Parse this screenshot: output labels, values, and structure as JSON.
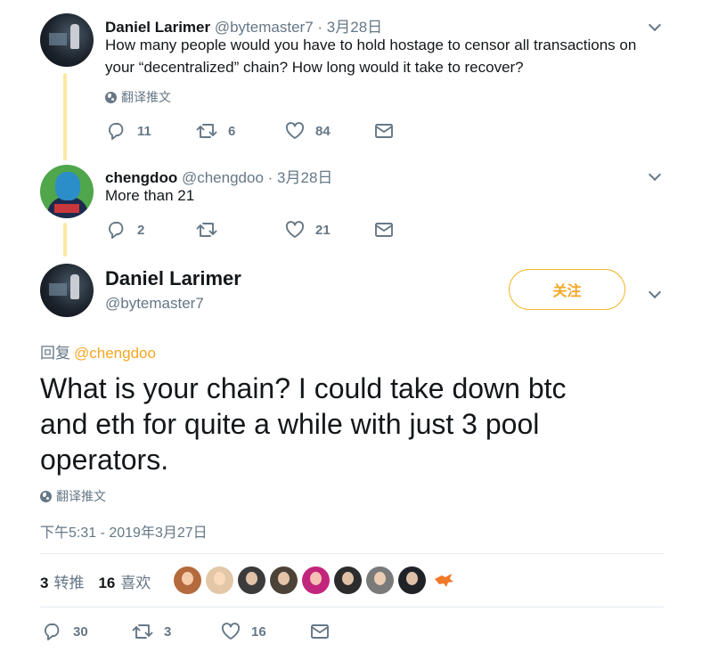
{
  "tweets": [
    {
      "name": "Daniel Larimer",
      "handle": "@bytemaster7",
      "dot": "·",
      "date": "3月28日",
      "text_line1": "How many people would you have to hold hostage to censor all transactions on",
      "text_line2": "your “decentralized” chain? How long would it take to recover?",
      "translate": "翻译推文",
      "replies": "11",
      "retweets": "6",
      "likes": "84"
    },
    {
      "name": "chengdoo",
      "handle": "@chengdoo",
      "dot": "·",
      "date": "3月28日",
      "text": "More than 21",
      "replies": "2",
      "retweets": "",
      "likes": "21"
    }
  ],
  "main": {
    "name": "Daniel Larimer",
    "handle": "@bytemaster7",
    "follow_label": "关注",
    "reply_prefix": "回复",
    "reply_mention": "@chengdoo",
    "text_line1": "What is your chain?  I could take down btc",
    "text_line2": "and eth for quite a while with just 3 pool",
    "text_line3": "operators.",
    "translate": "翻译推文",
    "timestamp": "下午5:31 - 2019年3月27日",
    "retweet_count": "3",
    "retweet_label": "转推",
    "like_count": "16",
    "like_label": "喜欢",
    "replies": "30",
    "retweets": "3",
    "likes": "16"
  },
  "liker_avatars": [
    {
      "icon": "avatar-bearded-man",
      "color": "#b46a3c"
    },
    {
      "icon": "avatar-smiling-man",
      "color": "#e3c8a8"
    },
    {
      "icon": "avatar-curly-hair",
      "color": "#3b3b3b"
    },
    {
      "icon": "avatar-group-photo",
      "color": "#4b4337"
    },
    {
      "icon": "avatar-magenta",
      "color": "#c2267c"
    },
    {
      "icon": "avatar-dark-portrait",
      "color": "#2c2c2c"
    },
    {
      "icon": "avatar-grey-portrait",
      "color": "#7a7a7a"
    },
    {
      "icon": "avatar-man-in-suit",
      "color": "#1f2226"
    },
    {
      "icon": "fox-logo",
      "color": "#f07a2a"
    }
  ],
  "colors": {
    "accent": "#f5a623",
    "secondary_text": "#657786",
    "thread_line": "#fbe8a4"
  }
}
